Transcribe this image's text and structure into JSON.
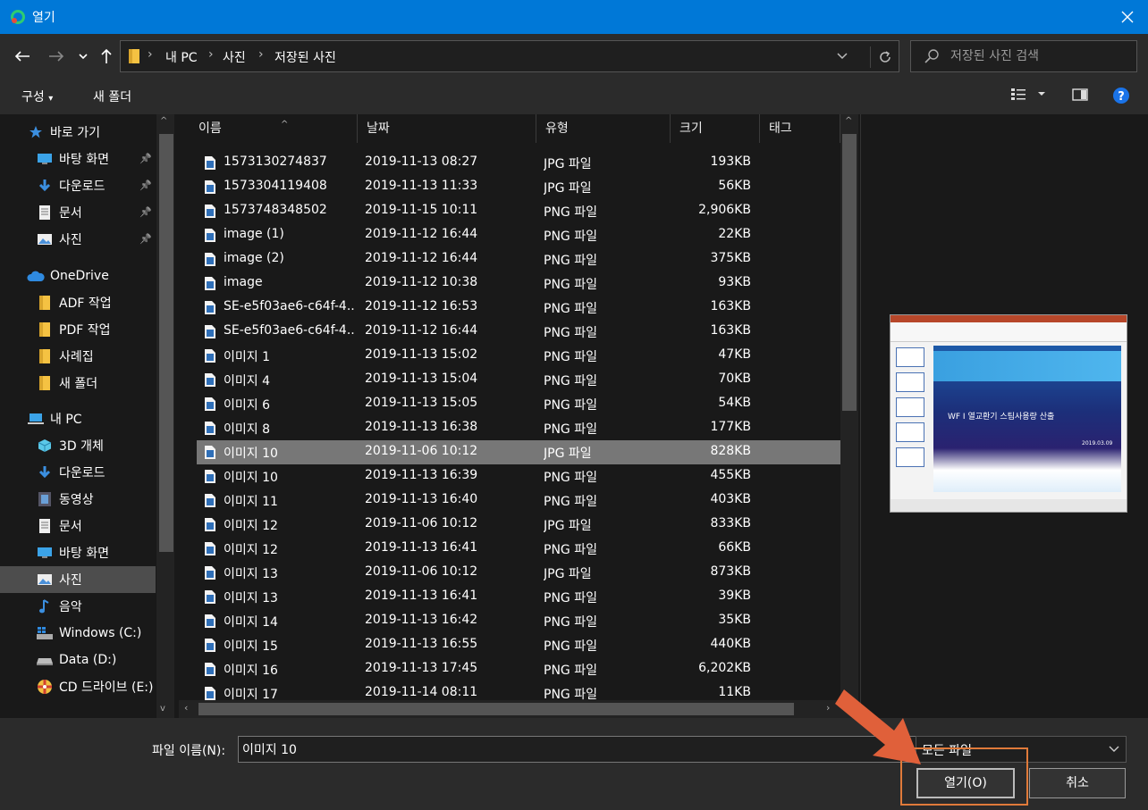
{
  "window": {
    "title": "열기",
    "accent": "#0078d7"
  },
  "address": {
    "crumbs": [
      "내 PC",
      "사진",
      "저장된 사진"
    ],
    "search_placeholder": "저장된 사진 검색"
  },
  "toolbar": {
    "organize_label": "구성",
    "new_folder_label": "새 폴더"
  },
  "nav": {
    "items": [
      {
        "label": "바로 가기",
        "icon": "star-icon"
      },
      {
        "label": "바탕 화면",
        "icon": "desktop-icon",
        "pinned": true
      },
      {
        "label": "다운로드",
        "icon": "download-icon",
        "pinned": true
      },
      {
        "label": "문서",
        "icon": "document-icon",
        "pinned": true
      },
      {
        "label": "사진",
        "icon": "pictures-icon",
        "pinned": true
      },
      {
        "label": "OneDrive",
        "icon": "cloud-icon"
      },
      {
        "label": "ADF 작업",
        "icon": "folder-icon"
      },
      {
        "label": "PDF 작업",
        "icon": "folder-icon"
      },
      {
        "label": "사례집",
        "icon": "folder-icon"
      },
      {
        "label": "새 폴더",
        "icon": "folder-icon"
      },
      {
        "label": "내 PC",
        "icon": "computer-icon"
      },
      {
        "label": "3D 개체",
        "icon": "cube-icon"
      },
      {
        "label": "다운로드",
        "icon": "download-icon"
      },
      {
        "label": "동영상",
        "icon": "video-icon"
      },
      {
        "label": "문서",
        "icon": "document-icon"
      },
      {
        "label": "바탕 화면",
        "icon": "desktop-icon"
      },
      {
        "label": "사진",
        "icon": "pictures-icon",
        "selected": true
      },
      {
        "label": "음악",
        "icon": "music-icon"
      },
      {
        "label": "Windows (C:)",
        "icon": "windows-drive-icon"
      },
      {
        "label": "Data (D:)",
        "icon": "drive-icon"
      },
      {
        "label": "CD 드라이브 (E:)",
        "icon": "cd-drive-icon"
      }
    ]
  },
  "columns": {
    "name": "이름",
    "date": "날짜",
    "type": "유형",
    "size": "크기",
    "tag": "태그"
  },
  "files": [
    {
      "name": "1573130274837",
      "date": "2019-11-13 08:27",
      "type": "JPG 파일",
      "size": "193KB"
    },
    {
      "name": "1573304119408",
      "date": "2019-11-13 11:33",
      "type": "JPG 파일",
      "size": "56KB"
    },
    {
      "name": "1573748348502",
      "date": "2019-11-15 10:11",
      "type": "PNG 파일",
      "size": "2,906KB"
    },
    {
      "name": "image (1)",
      "date": "2019-11-12 16:44",
      "type": "PNG 파일",
      "size": "22KB"
    },
    {
      "name": "image (2)",
      "date": "2019-11-12 16:44",
      "type": "PNG 파일",
      "size": "375KB"
    },
    {
      "name": "image",
      "date": "2019-11-12 10:38",
      "type": "PNG 파일",
      "size": "93KB"
    },
    {
      "name": "SE-e5f03ae6-c64f-4...",
      "date": "2019-11-12 16:53",
      "type": "PNG 파일",
      "size": "163KB"
    },
    {
      "name": "SE-e5f03ae6-c64f-4...",
      "date": "2019-11-12 16:44",
      "type": "PNG 파일",
      "size": "163KB"
    },
    {
      "name": "이미지 1",
      "date": "2019-11-13 15:02",
      "type": "PNG 파일",
      "size": "47KB"
    },
    {
      "name": "이미지 4",
      "date": "2019-11-13 15:04",
      "type": "PNG 파일",
      "size": "70KB"
    },
    {
      "name": "이미지 6",
      "date": "2019-11-13 15:05",
      "type": "PNG 파일",
      "size": "54KB"
    },
    {
      "name": "이미지 8",
      "date": "2019-11-13 16:38",
      "type": "PNG 파일",
      "size": "177KB"
    },
    {
      "name": "이미지 10",
      "date": "2019-11-06 10:12",
      "type": "JPG 파일",
      "size": "828KB",
      "selected": true
    },
    {
      "name": "이미지 10",
      "date": "2019-11-13 16:39",
      "type": "PNG 파일",
      "size": "455KB"
    },
    {
      "name": "이미지 11",
      "date": "2019-11-13 16:40",
      "type": "PNG 파일",
      "size": "403KB"
    },
    {
      "name": "이미지 12",
      "date": "2019-11-06 10:12",
      "type": "JPG 파일",
      "size": "833KB"
    },
    {
      "name": "이미지 12",
      "date": "2019-11-13 16:41",
      "type": "PNG 파일",
      "size": "66KB"
    },
    {
      "name": "이미지 13",
      "date": "2019-11-06 10:12",
      "type": "JPG 파일",
      "size": "873KB"
    },
    {
      "name": "이미지 13",
      "date": "2019-11-13 16:41",
      "type": "PNG 파일",
      "size": "39KB"
    },
    {
      "name": "이미지 14",
      "date": "2019-11-13 16:42",
      "type": "PNG 파일",
      "size": "35KB"
    },
    {
      "name": "이미지 15",
      "date": "2019-11-13 16:55",
      "type": "PNG 파일",
      "size": "440KB"
    },
    {
      "name": "이미지 16",
      "date": "2019-11-13 17:45",
      "type": "PNG 파일",
      "size": "6,202KB"
    },
    {
      "name": "이미지 17",
      "date": "2019-11-14 08:11",
      "type": "PNG 파일",
      "size": "11KB"
    }
  ],
  "preview": {
    "slide_title": "WF I 열교환기 스팀사용량 산출",
    "slide_date": "2019.03.09"
  },
  "footer": {
    "filename_label": "파일 이름(N):",
    "filename_value": "이미지 10",
    "filetype_value": "모든 파일",
    "open_label": "열기(O)",
    "cancel_label": "취소",
    "highlight_color": "#e07a3a"
  }
}
